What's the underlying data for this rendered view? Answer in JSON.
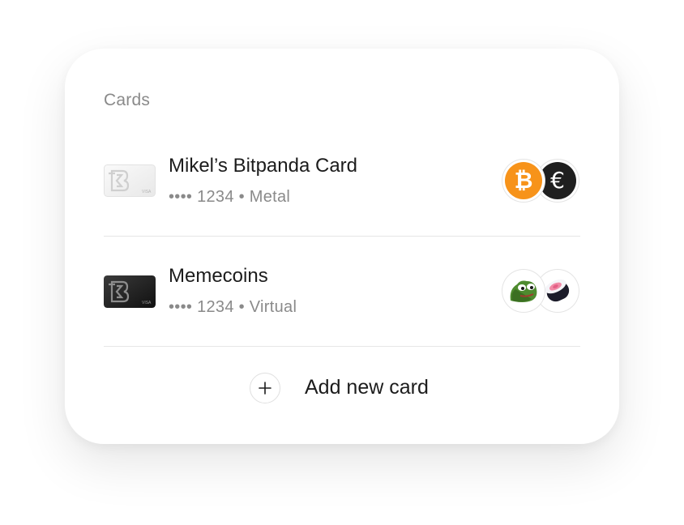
{
  "section": {
    "title": "Cards"
  },
  "cards": [
    {
      "name": "Mikel’s Bitpanda Card",
      "details": "•••• 1234 • Metal",
      "card_style": "metal-light",
      "card_brand_text": "VISA",
      "assets": [
        "bitcoin-icon",
        "euro-icon"
      ]
    },
    {
      "name": "Memecoins",
      "details": "•••• 1234 • Virtual",
      "card_style": "dark",
      "card_brand_text": "VISA",
      "assets": [
        "pepe-frog-icon",
        "sushi-icon"
      ]
    }
  ],
  "add_card": {
    "label": "Add new card",
    "icon": "plus-icon"
  },
  "colors": {
    "bitcoin": "#F7931A",
    "euro": "#1F1F1F",
    "text_primary": "#1C1C1C",
    "text_secondary": "#8A8A8A"
  }
}
